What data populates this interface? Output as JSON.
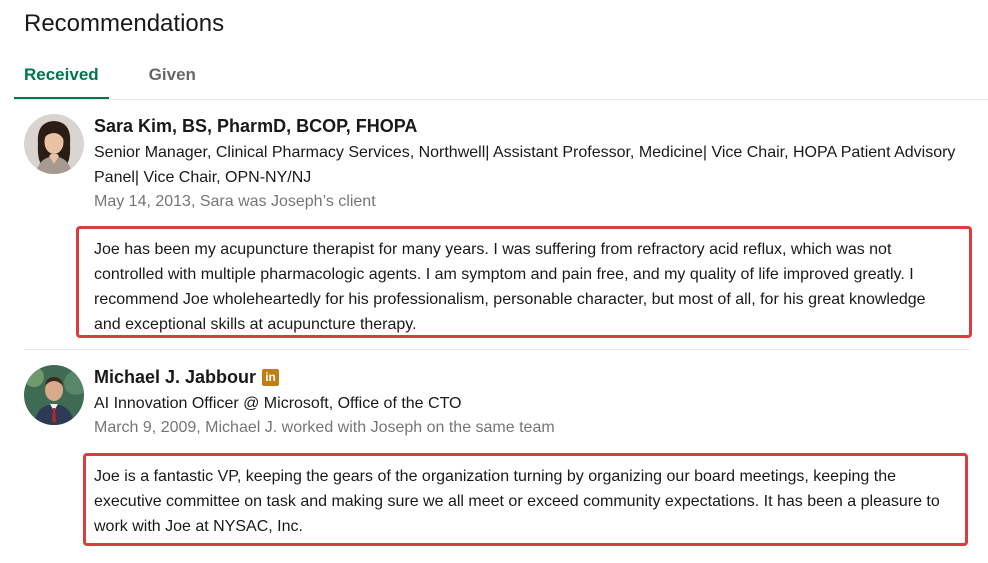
{
  "header": {
    "title": "Recommendations"
  },
  "tabs": [
    {
      "label": "Received",
      "active": true
    },
    {
      "label": "Given",
      "active": false
    }
  ],
  "recommendations": [
    {
      "name": "Sara Kim, BS, PharmD, BCOP, FHOPA",
      "headline": "Senior Manager, Clinical Pharmacy Services, Northwell| Assistant Professor, Medicine| Vice Chair, HOPA Patient Advisory Panel| Vice Chair, OPN-NY/NJ",
      "date_relation": "May 14, 2013, Sara was Joseph’s client",
      "text": "Joe has been my acupuncture therapist for many years. I was suffering from refractory acid reflux, which was not controlled with multiple pharmacologic agents. I am symptom and pain free, and my quality of life improved greatly. I recommend Joe wholeheartedly for his professionalism, personable character, but most of all, for his great knowledge and exceptional skills at acupuncture therapy."
    },
    {
      "name": "Michael J. Jabbour",
      "badge": "in",
      "headline": "AI Innovation Officer @ Microsoft, Office of the CTO",
      "date_relation": "March 9, 2009, Michael J. worked with Joseph on the same team",
      "text": "Joe is a fantastic VP, keeping the gears of the organization turning by organizing our board meetings, keeping the executive committee on task and making sure we all meet or exceed community expectations. It has been a pleasure to work with Joe at NYSAC, Inc."
    }
  ],
  "colors": {
    "accent": "#01754f",
    "highlight_border": "#d93d3d",
    "badge": "#c37d16"
  }
}
